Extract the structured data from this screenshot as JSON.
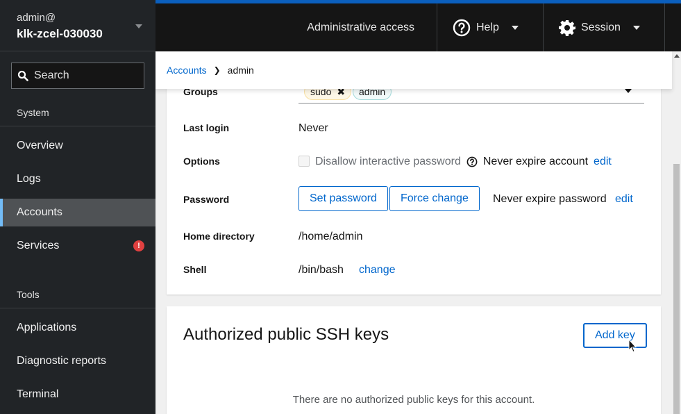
{
  "host": {
    "user": "admin@",
    "name": "klk-zcel-030030"
  },
  "search": {
    "placeholder": "Search",
    "value": ""
  },
  "sidebar": {
    "sections": [
      {
        "label": "System",
        "items": [
          {
            "label": "Overview",
            "active": false
          },
          {
            "label": "Logs",
            "active": false
          },
          {
            "label": "Accounts",
            "active": true
          },
          {
            "label": "Services",
            "active": false,
            "badge": "!"
          }
        ]
      },
      {
        "label": "Tools",
        "items": [
          {
            "label": "Applications"
          },
          {
            "label": "Diagnostic reports"
          },
          {
            "label": "Terminal"
          }
        ]
      }
    ]
  },
  "topbar": {
    "admin_access": "Administrative access",
    "help": "Help",
    "session": "Session",
    "accent_color": "#0b5fbd"
  },
  "breadcrumb": {
    "parent": "Accounts",
    "current": "admin"
  },
  "account": {
    "groups_label": "Groups",
    "groups": [
      "sudo",
      "admin"
    ],
    "last_login_label": "Last login",
    "last_login_value": "Never",
    "options_label": "Options",
    "disallow_password_label": "Disallow interactive password",
    "disallow_password_checked": false,
    "never_expire_account": "Never expire account",
    "edit_account_expiry": "edit",
    "password_label": "Password",
    "set_password": "Set password",
    "force_change": "Force change",
    "never_expire_password": "Never expire password",
    "edit_password_expiry": "edit",
    "home_label": "Home directory",
    "home_value": "/home/admin",
    "shell_label": "Shell",
    "shell_value": "/bin/bash",
    "shell_change": "change"
  },
  "ssh_keys": {
    "title": "Authorized public SSH keys",
    "add_key": "Add key",
    "empty_message": "There are no authorized public keys for this account."
  }
}
